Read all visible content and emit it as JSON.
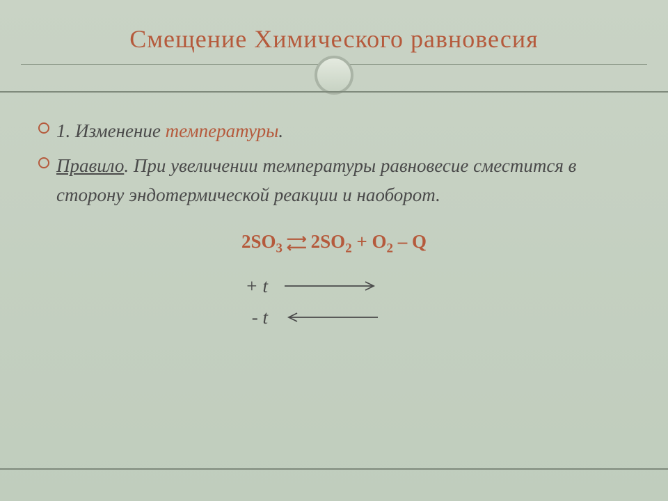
{
  "title": "Смещение Химического равновесия",
  "bullet1": {
    "prefix": "1. Изменение ",
    "highlight": "температуры",
    "suffix": "."
  },
  "bullet2": {
    "rule_label": "Правило",
    "rule_text": ". При увеличении температуры равновесие сместится в сторону эндотермической реакции и наоборот."
  },
  "equation": {
    "left": "2SO",
    "left_sub": "3",
    "right1": "2SO",
    "right1_sub": "2",
    "right2": " + O",
    "right2_sub": "2",
    "right3": " – Q"
  },
  "temp": {
    "plus": "+ t",
    "minus": "- t"
  }
}
